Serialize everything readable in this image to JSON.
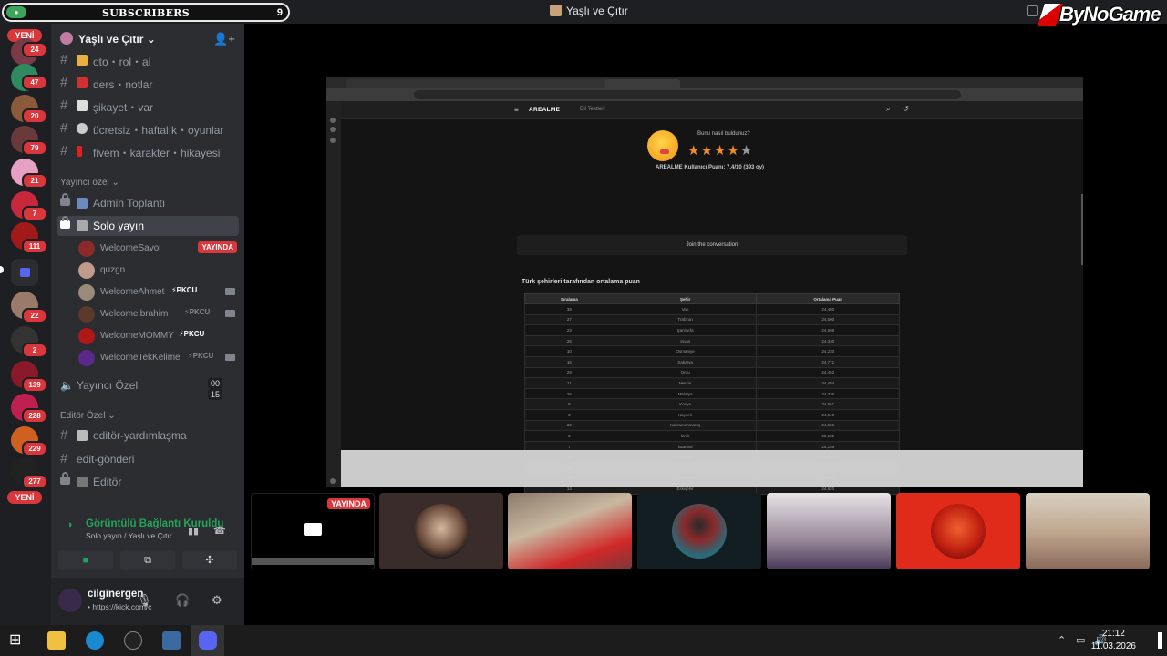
{
  "topbar": {
    "subscribers_label": "SUBSCRIBERS",
    "subscribers_count": "9",
    "window_title": "Yaşlı ve Çıtır",
    "brand": "ByNoGame"
  },
  "rail": {
    "new_label": "YENİ",
    "badges": [
      "24",
      "47",
      "20",
      "79",
      "21",
      "7",
      "111",
      "22",
      "2",
      "139",
      "228",
      "229",
      "277"
    ]
  },
  "sidebar": {
    "guild_name": "Yaşlı ve Çıtır",
    "channels_top": [
      "oto・rol・al",
      "ders・notlar",
      "şikayet・var",
      "ücretsiz・haftalık・oyunlar",
      "fivem・karakter・hikayesi"
    ],
    "category_streamer": "Yayıncı özel",
    "ch_admin": "Admin Toplantı",
    "ch_solo": "Solo yayın",
    "voice_users": [
      {
        "name": "WelcomeSavoi",
        "tag": ""
      },
      {
        "name": "quzgn",
        "tag": ""
      },
      {
        "name": "WelcomeAhmet",
        "tag": "PKCU"
      },
      {
        "name": "Welcomelbrahim",
        "tag": "PKCU"
      },
      {
        "name": "WelcomeMOMMY",
        "tag": "PKCU"
      },
      {
        "name": "WelcomeTekKelime",
        "tag": "PKCU"
      }
    ],
    "live_label": "YAYINDA",
    "ch_streamer_voice": "Yayıncı Özel",
    "voice_counts": [
      "00",
      "15"
    ],
    "category_editor": "Editör Özel",
    "ch_editor_help": "editör-yardımlaşma",
    "ch_edit_send": "edit-gönderi",
    "ch_editor": "Editör"
  },
  "voice_panel": {
    "status": "Görüntülü Bağlantı Kuruldu",
    "location": "Solo yayın / Yaşlı ve Çıtır"
  },
  "user": {
    "name": "cilginergen",
    "status": "• https://kick.com/c"
  },
  "browser": {
    "site_logo": "AREALME",
    "section": "Dil Testleri",
    "rating_question": "Bunu nasıl buldunuz?",
    "rating_stars": 4,
    "rating_max": 5,
    "score_text": "AREALME Kullanıcı Puanı: 7.4/10 (393 oy)",
    "join_text": "Join the conversation",
    "table_title": "Türk şehirleri tarafından ortalama puan",
    "columns": [
      "Sıralama",
      "Şehir",
      "Ortalama Puan"
    ],
    "rows": [
      [
        "39",
        "Van",
        "24,480"
      ],
      [
        "27",
        "Trabzon",
        "24,500"
      ],
      [
        "23",
        "Şanlıurfa",
        "24,598"
      ],
      [
        "26",
        "Sivas",
        "24,330"
      ],
      [
        "10",
        "Osmaniye",
        "24,230"
      ],
      [
        "16",
        "Sakarya",
        "24,771"
      ],
      [
        "29",
        "Ordu",
        "24,452"
      ],
      [
        "11",
        "Mersin",
        "24,484"
      ],
      [
        "25",
        "Malatya",
        "24,336"
      ],
      [
        "8",
        "Konya",
        "24,561"
      ],
      [
        "3",
        "Kayseri",
        "24,940"
      ],
      [
        "22",
        "Kahramanmaraş",
        "24,626"
      ],
      [
        "2",
        "İzmir",
        "25,102"
      ],
      [
        "7",
        "İstanbul",
        "25,159"
      ],
      [
        "20",
        "Gölcük",
        "24,481"
      ],
      [
        "19",
        "Gebze",
        "24,684"
      ],
      [
        "13",
        "Gaziantep",
        "24,849"
      ],
      [
        "14",
        "Eskişehir",
        "24,820"
      ]
    ]
  },
  "tiles": {
    "live_label": "YAYINDA"
  },
  "taskbar": {
    "time": "21:12",
    "date": "11.03.2026"
  }
}
